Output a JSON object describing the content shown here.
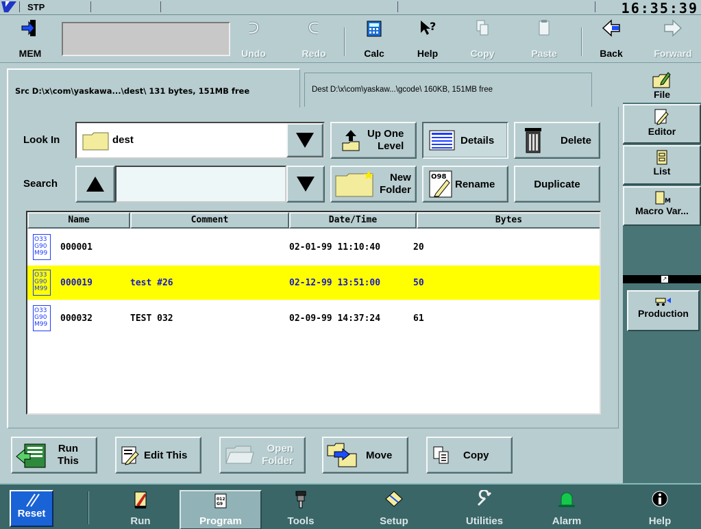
{
  "titlebar": {
    "status": "STP",
    "clock": "16:35:39"
  },
  "toolbar": {
    "mem_label": "MEM",
    "undo_label": "Undo",
    "redo_label": "Redo",
    "calc_label": "Calc",
    "help_label": "Help",
    "copy_label": "Copy",
    "paste_label": "Paste",
    "back_label": "Back",
    "forward_label": "Forward"
  },
  "tabs": {
    "src": "Src D:\\x\\com\\yaskawa...\\dest\\    131 bytes, 151MB free",
    "dest": "Dest D:\\x\\com\\yaskaw...\\gcode\\    160KB, 151MB free"
  },
  "browser": {
    "look_in_label": "Look In",
    "look_in_value": "dest",
    "search_label": "Search",
    "search_value": "",
    "up_one_level": [
      "Up One",
      "Level"
    ],
    "details": "Details",
    "delete": "Delete",
    "new_folder": [
      "New",
      "Folder"
    ],
    "rename": "Rename",
    "duplicate": "Duplicate"
  },
  "table": {
    "columns": [
      "Name",
      "Comment",
      "Date/Time",
      "Bytes"
    ],
    "rows": [
      {
        "name": "000001",
        "comment": "",
        "datetime": "02-01-99 11:10:40",
        "bytes": "20",
        "selected": false
      },
      {
        "name": "000019",
        "comment": "test #26",
        "datetime": "02-12-99 13:51:00",
        "bytes": "50",
        "selected": true
      },
      {
        "name": "000032",
        "comment": "TEST 032",
        "datetime": "02-09-99 14:37:24",
        "bytes": "61",
        "selected": false
      }
    ],
    "file_icon_text": [
      "O33",
      "G90",
      "M99"
    ]
  },
  "actions": {
    "run_this": [
      "Run",
      "This"
    ],
    "edit_this": "Edit This",
    "open_folder": [
      "Open",
      "Folder"
    ],
    "move": "Move",
    "copy": "Copy"
  },
  "side": {
    "file": "File",
    "editor": "Editor",
    "list": "List",
    "macro": "Macro Var...",
    "production": "Production"
  },
  "nav": {
    "reset": "Reset",
    "run": "Run",
    "program": "Program",
    "tools": "Tools",
    "setup": "Setup",
    "utilities": "Utilities",
    "alarm": "Alarm",
    "help": "Help"
  }
}
